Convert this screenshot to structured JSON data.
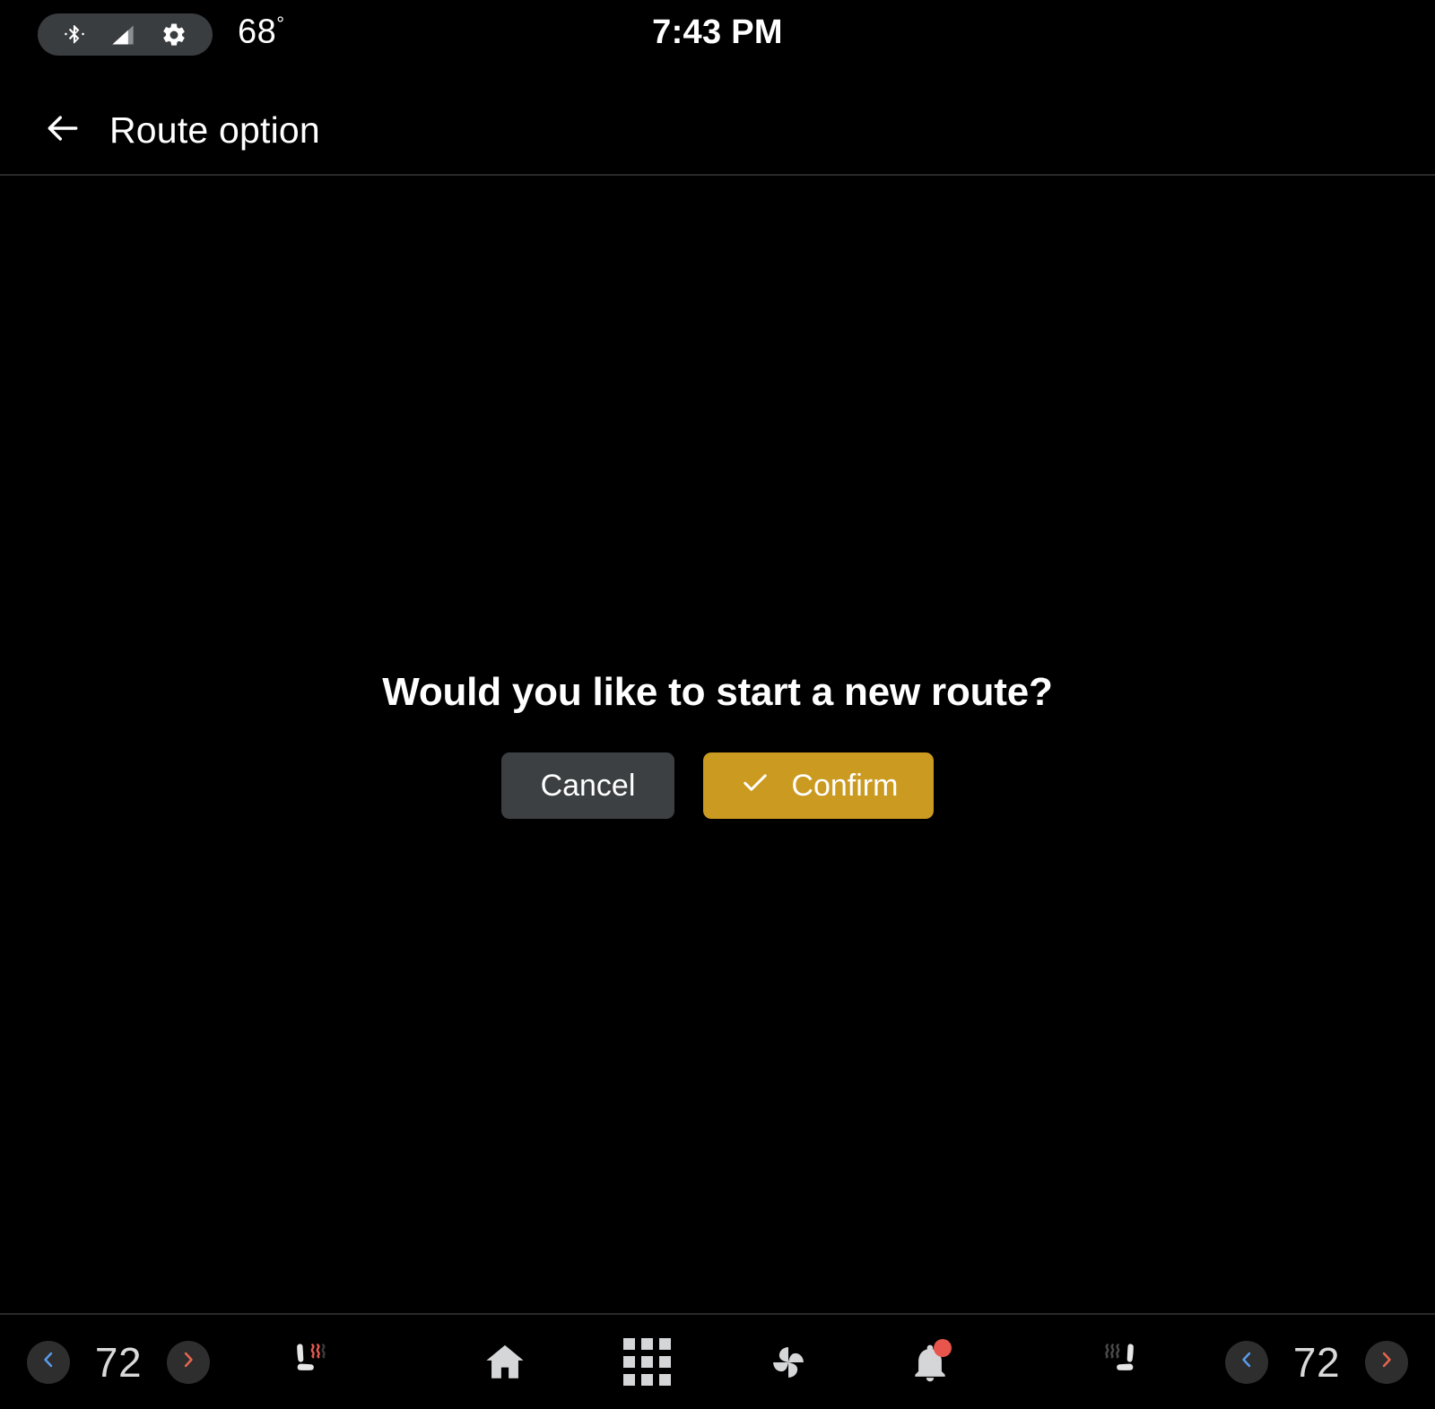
{
  "status_bar": {
    "bluetooth_icon": "bluetooth-icon",
    "signal_icon": "signal-strength-icon",
    "settings_icon": "gear-icon",
    "outside_temp": "68",
    "degree_symbol": "°",
    "clock": "7:43 PM"
  },
  "header": {
    "back_icon": "back-arrow-icon",
    "title": "Route option"
  },
  "dialog": {
    "message": "Would you like to start a new route?",
    "cancel_label": "Cancel",
    "confirm_label": "Confirm",
    "confirm_icon": "check-icon",
    "cancel_bg": "#3c4043",
    "confirm_bg": "#cb9a20"
  },
  "bottom_bar": {
    "left_climate": {
      "decrease_icon": "chevron-left-icon",
      "temperature": "72",
      "increase_icon": "chevron-right-icon",
      "decrease_color": "#5a9ced",
      "increase_color": "#e8664f"
    },
    "left_seat_heater_icon": "heated-seat-icon",
    "nav_items": [
      {
        "name": "home-icon",
        "label": "Home"
      },
      {
        "name": "apps-grid-icon",
        "label": "Apps"
      },
      {
        "name": "fan-icon",
        "label": "Climate"
      },
      {
        "name": "bell-icon",
        "label": "Notifications"
      }
    ],
    "notification_badge_color": "#e8554c",
    "right_seat_heater_icon": "heated-seat-icon",
    "right_climate": {
      "decrease_icon": "chevron-left-icon",
      "temperature": "72",
      "increase_icon": "chevron-right-icon",
      "decrease_color": "#5a9ced",
      "increase_color": "#e8664f"
    }
  }
}
